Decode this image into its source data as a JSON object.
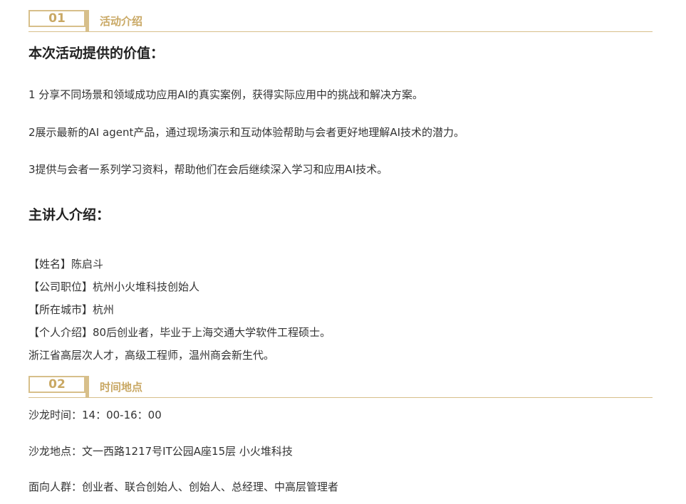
{
  "section1": {
    "number": "01",
    "title": "活动介绍"
  },
  "value": {
    "heading": "本次活动提供的价值：",
    "items": [
      "1 分享不同场景和领域成功应用AI的真实案例，获得实际应用中的挑战和解决方案。",
      "2展示最新的AI agent产品，通过现场演示和互动体验帮助与会者更好地理解AI技术的潜力。",
      "3提供与会者一系列学习资料，帮助他们在会后继续深入学习和应用AI技术。"
    ]
  },
  "speaker": {
    "heading": "主讲人介绍：",
    "lines": [
      "【姓名】陈启斗",
      "【公司职位】杭州小火堆科技创始人",
      "【所在城市】杭州",
      "【个人介绍】80后创业者，毕业于上海交通大学软件工程硕士。",
      "浙江省高层次人才，高级工程师，温州商会新生代。"
    ]
  },
  "section2": {
    "number": "02",
    "title": "时间地点"
  },
  "event": {
    "time": "沙龙时间：14：00-16：00",
    "location": "沙龙地点：文一西路1217号IT公园A座15层 小火堆科技",
    "audience": "面向人群：创业者、联合创始人、创始人、总经理、中高层管理者"
  },
  "colors": {
    "accent": "#d7bf8a",
    "accent_text": "#c9a864",
    "text": "#333333"
  }
}
